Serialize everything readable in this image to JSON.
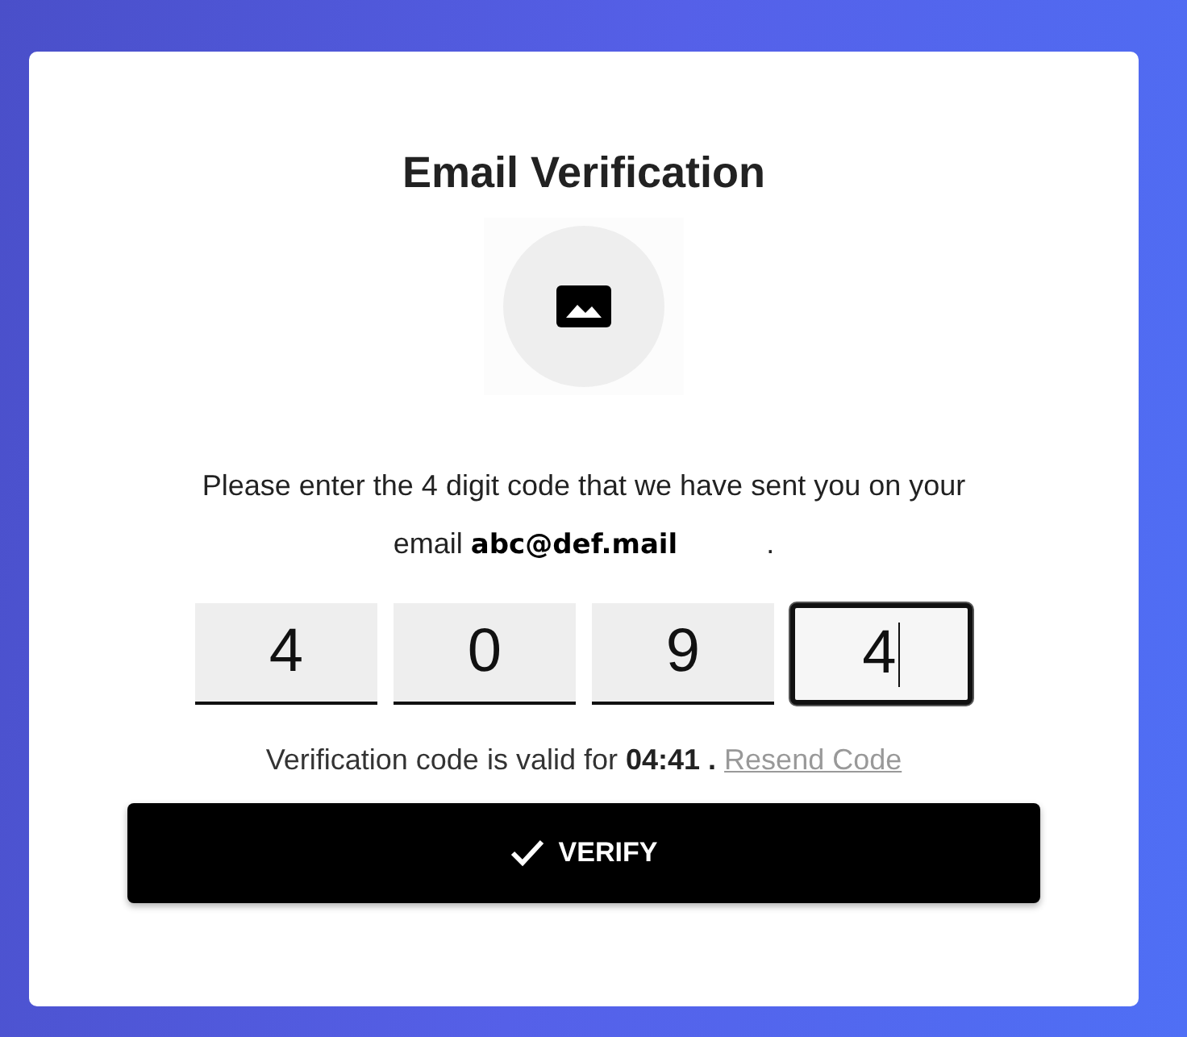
{
  "title": "Email Verification",
  "message": "Please enter the 4 digit code that we have sent you on your email **abc@def.mail**           .",
  "digits": [
    {
      "value": "4",
      "focused": false
    },
    {
      "value": "0",
      "focused": false
    },
    {
      "value": "9",
      "focused": false
    },
    {
      "value": "4",
      "focused": true
    }
  ],
  "timer_text": "Verification code is valid for **04:41 .**",
  "resend_link": "Resend Code",
  "verify_button": "VERIFY"
}
